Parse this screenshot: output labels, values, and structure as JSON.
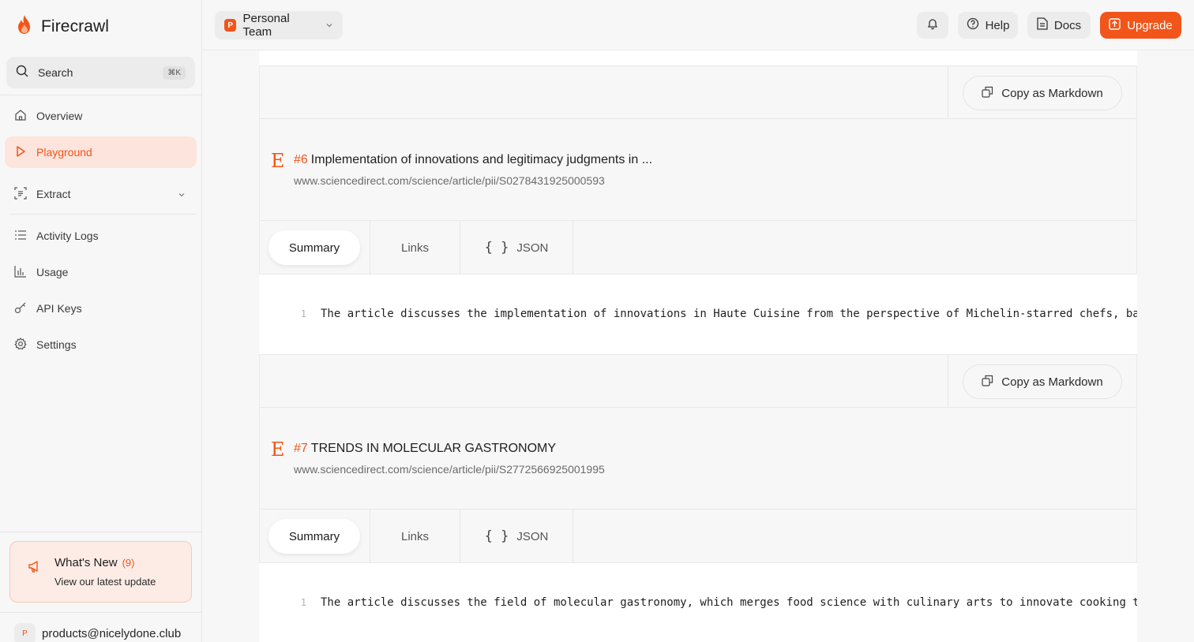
{
  "app": {
    "name": "Firecrawl"
  },
  "sidebar": {
    "search": {
      "label": "Search",
      "shortcut": "⌘K"
    },
    "items": [
      {
        "label": "Overview",
        "icon": "home-icon"
      },
      {
        "label": "Playground",
        "icon": "play-icon",
        "active": true
      },
      {
        "label": "Extract",
        "icon": "extract-icon",
        "expandable": true
      },
      {
        "label": "Activity Logs",
        "icon": "list-icon"
      },
      {
        "label": "Usage",
        "icon": "bar-chart-icon"
      },
      {
        "label": "API Keys",
        "icon": "key-icon"
      },
      {
        "label": "Settings",
        "icon": "gear-icon"
      }
    ],
    "whats_new": {
      "title": "What's New",
      "count": "(9)",
      "subtitle": "View our latest update"
    },
    "account": {
      "avatar": "P",
      "email": "products@nicelydone.club"
    }
  },
  "topbar": {
    "team": {
      "badge": "P",
      "label": "Personal Team"
    },
    "help_label": "Help",
    "docs_label": "Docs",
    "upgrade_label": "Upgrade"
  },
  "results": [
    {
      "number": "#6",
      "title": "Implementation of innovations and legitimacy judgments in ...",
      "url": "www.sciencedirect.com/science/article/pii/S0278431925000593",
      "tabs": [
        "Summary",
        "Links",
        "JSON"
      ],
      "active_tab": "Summary",
      "line_number": "1",
      "summary": "The article discusses the implementation of innovations in Haute Cuisine from the perspective of Michelin-starred chefs, ba",
      "copy_label": "Copy as Markdown"
    },
    {
      "number": "#7",
      "title": "TRENDS IN MOLECULAR GASTRONOMY",
      "url": "www.sciencedirect.com/science/article/pii/S2772566925001995",
      "tabs": [
        "Summary",
        "Links",
        "JSON"
      ],
      "active_tab": "Summary",
      "line_number": "1",
      "summary": "The article discusses the field of molecular gastronomy, which merges food science with culinary arts to innovate cooking t"
    }
  ],
  "top_copy_label": "Copy as Markdown",
  "colors": {
    "accent": "#f2551a",
    "accent_soft": "#fde4dc"
  }
}
